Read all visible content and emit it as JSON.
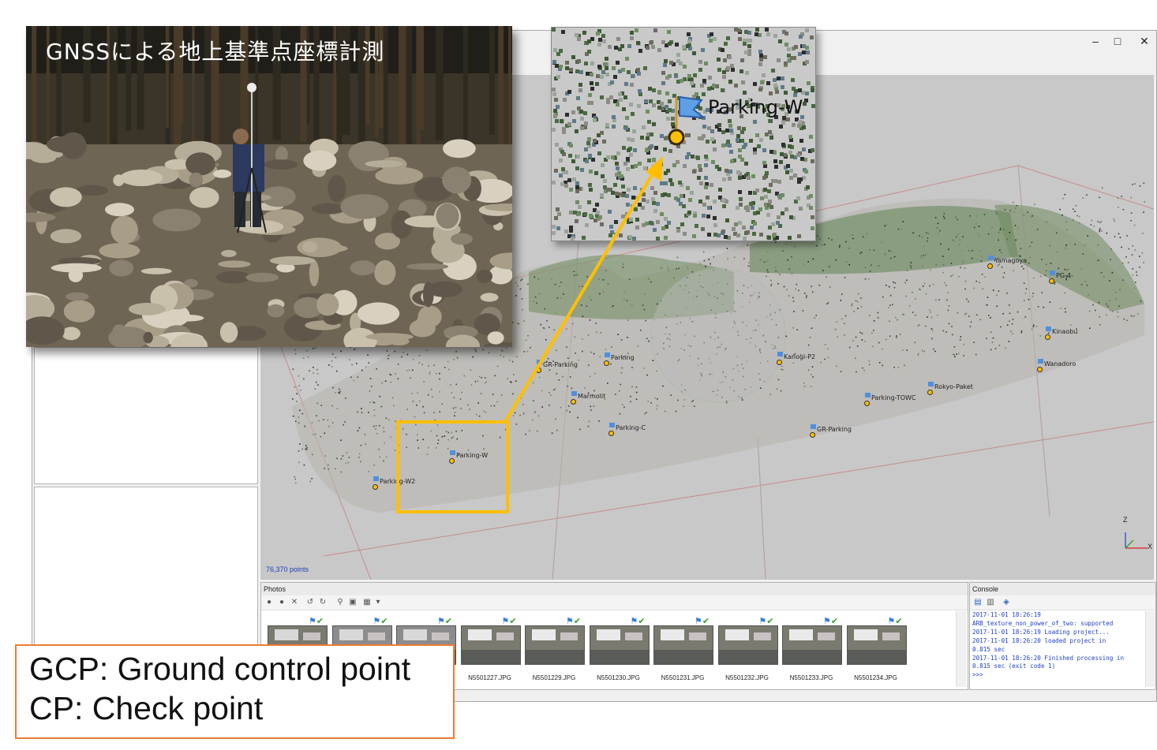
{
  "window": {
    "controls": {
      "minimize": "–",
      "maximize": "□",
      "close": "✕"
    }
  },
  "viewport": {
    "point_count": "76,370 points",
    "axis_z": "Z",
    "axis_x": "X",
    "markers": [
      "GR-Parking",
      "Parking",
      "Kanogi-P2",
      "Parking-W",
      "Parking-W2",
      "Marmolit",
      "Parking-C",
      "GR-Parking",
      "Yamagoya",
      "PG-4-",
      "Parking-TOWC",
      "Wanadoro",
      "Kinaobu",
      "Rokyo-Paket"
    ]
  },
  "overlay_photo": {
    "title": "GNSSによる地上基準点座標計測"
  },
  "zoom_inset": {
    "label": "Parking-W"
  },
  "photos_panel": {
    "title": "Photos",
    "thumbnails": [
      {
        "name": ""
      },
      {
        "name": ""
      },
      {
        "name": ""
      },
      {
        "name": "N5501227.JPG"
      },
      {
        "name": "N5501229.JPG"
      },
      {
        "name": "N5501230.JPG"
      },
      {
        "name": "N5501231.JPG"
      },
      {
        "name": "N5501232.JPG"
      },
      {
        "name": "N5501233.JPG"
      },
      {
        "name": "N5501234.JPG"
      }
    ]
  },
  "console_panel": {
    "title": "Console",
    "log": "2017-11-01 18:26:19\nARB_texture_non_power_of_two: supported\n2017-11-01 18:26:19 Loading project...\n2017-11-01 18:26:20 loaded project in\n0.815 sec\n2017-11-01 18:26:20 Finished processing in\n0.815 sec (exit code 1)\n>>>"
  },
  "legend": {
    "line1": "GCP: Ground control point",
    "line2": "CP: Check point"
  },
  "colors": {
    "highlight": "#ffbf00",
    "legend_border": "#ed7d31",
    "console_text": "#1e3fc6",
    "viewport_bg": "#c8c8c8"
  }
}
